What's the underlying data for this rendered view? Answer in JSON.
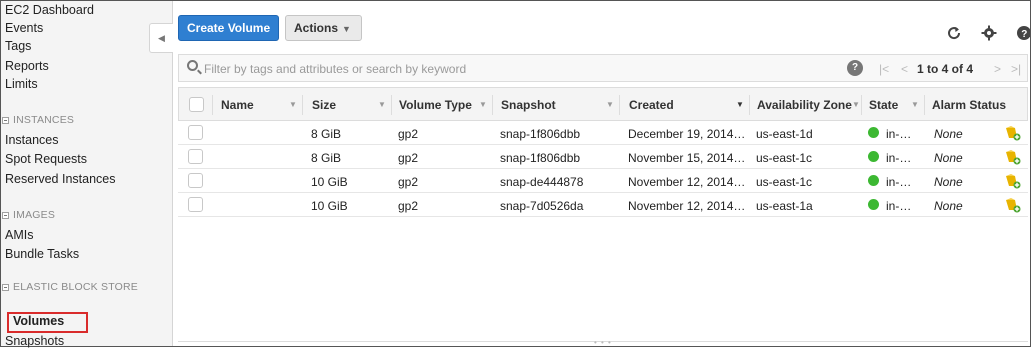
{
  "sidebar": {
    "top_items": [
      "EC2 Dashboard",
      "Events",
      "Tags",
      "Reports",
      "Limits"
    ],
    "instances_header": "INSTANCES",
    "instances_items": [
      "Instances",
      "Spot Requests",
      "Reserved Instances"
    ],
    "images_header": "IMAGES",
    "images_items": [
      "AMIs",
      "Bundle Tasks"
    ],
    "ebs_header": "ELASTIC BLOCK STORE",
    "ebs_items": [
      "Volumes",
      "Snapshots"
    ],
    "active_item": "Volumes"
  },
  "toolbar": {
    "create_label": "Create Volume",
    "actions_label": "Actions",
    "accent_color": "#2f7fd1"
  },
  "filter": {
    "placeholder": "Filter by tags and attributes or search by keyword",
    "help": "?",
    "pager_first": "|<",
    "pager_prev": "<",
    "pager_text": "1 to 4 of 4",
    "pager_next": ">",
    "pager_last": ">|"
  },
  "table": {
    "headers": [
      "Name",
      "Size",
      "Volume Type",
      "Snapshot",
      "Created",
      "Availability Zone",
      "State",
      "Alarm Status"
    ],
    "rows": [
      {
        "name": "",
        "size": "8 GiB",
        "type": "gp2",
        "snapshot": "snap-1f806dbb",
        "created": "December 19, 2014…",
        "zone": "us-east-1d",
        "state": "in-…",
        "alarm": "None"
      },
      {
        "name": "",
        "size": "8 GiB",
        "type": "gp2",
        "snapshot": "snap-1f806dbb",
        "created": "November 15, 2014…",
        "zone": "us-east-1c",
        "state": "in-…",
        "alarm": "None"
      },
      {
        "name": "",
        "size": "10 GiB",
        "type": "gp2",
        "snapshot": "snap-de444878",
        "created": "November 12, 2014…",
        "zone": "us-east-1c",
        "state": "in-…",
        "alarm": "None"
      },
      {
        "name": "",
        "size": "10 GiB",
        "type": "gp2",
        "snapshot": "snap-7d0526da",
        "created": "November 12, 2014…",
        "zone": "us-east-1a",
        "state": "in-…",
        "alarm": "None"
      }
    ],
    "state_color": "#3cb832"
  },
  "icons": {
    "refresh": "refresh-icon",
    "settings": "gear-icon",
    "help": "help-icon",
    "alarm": "add-alarm-icon"
  }
}
